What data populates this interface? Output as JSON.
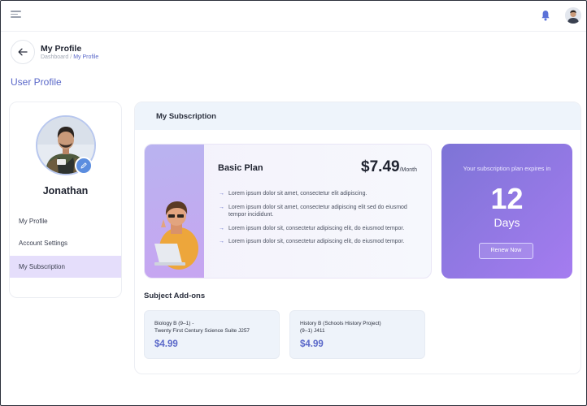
{
  "header": {
    "title": "My Profile",
    "breadcrumb": [
      "Dashboard",
      "My Profile"
    ],
    "breadcrumb_separator": "/"
  },
  "section_heading": "User Profile",
  "profile": {
    "name": "Jonathan",
    "menu": [
      {
        "label": "My Profile",
        "active": false
      },
      {
        "label": "Account Settings",
        "active": false
      },
      {
        "label": "My Subscription",
        "active": true
      }
    ]
  },
  "subscription": {
    "title": "My Subscription",
    "plan": {
      "name": "Basic Plan",
      "price": "$7.49",
      "period": "/Month",
      "features": [
        "Lorem ipsum dolor sit amet, consectetur elit adipiscing.",
        "Lorem ipsum dolor sit amet, consectetur adipiscing elit sed do eiusmod tempor incididunt.",
        "Lorem ipsum dolor sit, consectetur adipiscing elit, do eiusmod tempor.",
        "Lorem ipsum dolor sit, consectetur adipiscing elit, do eiusmod tempor."
      ]
    },
    "expiry": {
      "text": "Your subscription plan expires in",
      "number": "12",
      "unit": "Days",
      "renew_label": "Renew Now"
    },
    "addons_title": "Subject Add-ons",
    "addons": [
      {
        "name_line1": "Biology B (9–1) -",
        "name_line2": "Twenty First Century Science Suite J257",
        "price": "$4.99"
      },
      {
        "name_line1": "History B (Schools History Project)",
        "name_line2": "(9–1) J411",
        "price": "$4.99"
      }
    ]
  },
  "colors": {
    "accent": "#5b69c9",
    "active_menu": "#e5defb",
    "expiry_gradient_start": "#7d74d6",
    "expiry_gradient_end": "#a57cf0"
  },
  "icons": [
    "hamburger-menu-icon",
    "bell-icon",
    "user-avatar",
    "back-arrow-icon",
    "pencil-icon",
    "arrow-bullet-icon"
  ]
}
